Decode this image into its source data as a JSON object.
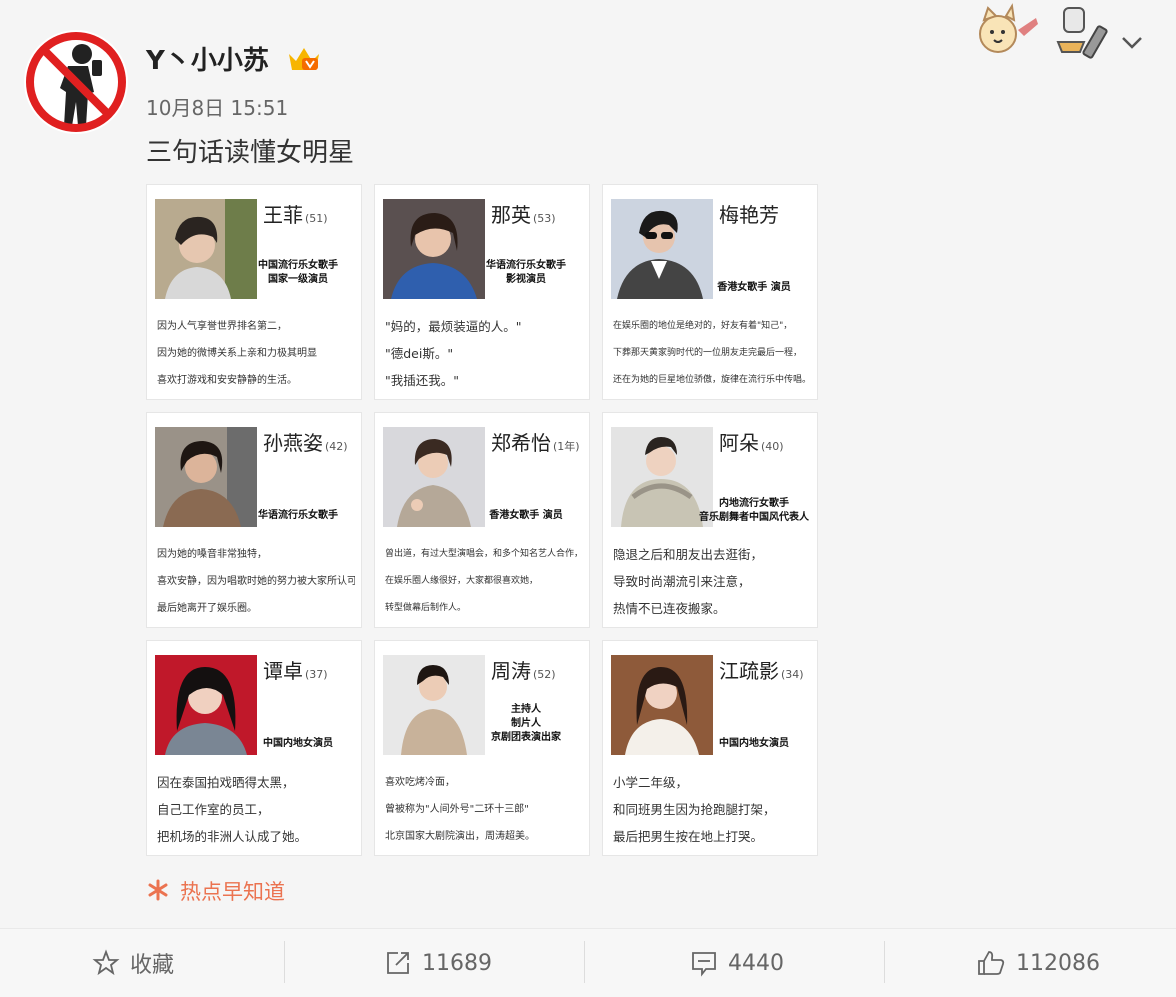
{
  "post": {
    "username": "Y丶小小苏",
    "time": "10月8日 15:51",
    "text": "三句话读懂女明星"
  },
  "cards": [
    {
      "name": "王菲",
      "age": "(51)",
      "role": [
        "中国流行乐女歌手",
        "国家一级演员"
      ],
      "lines": [
        "因为人气享誉世界排名第二，",
        "因为她的微博关系上亲和力极其明显",
        "喜欢打游戏和安安静静的生活。"
      ]
    },
    {
      "name": "那英",
      "age": "(53)",
      "role": [
        "华语流行乐女歌手",
        "影视演员"
      ],
      "lines": [
        "\"妈的，最烦装逼的人。\"",
        "\"德dei斯。\"",
        "\"我插还我。\""
      ]
    },
    {
      "name": "梅艳芳",
      "age": "",
      "role": [
        "香港女歌手 演员"
      ],
      "lines": [
        "在娱乐圈的地位是绝对的，好友有着\"知己\"，",
        "下葬那天黄家驹时代的一位朋友走完最后一程，",
        "还在为她的巨星地位骄傲，旋律在流行乐中传唱。"
      ]
    },
    {
      "name": "孙燕姿",
      "age": "(42)",
      "role": [
        "华语流行乐女歌手"
      ],
      "lines": [
        "因为她的嗓音非常独特，",
        "喜欢安静，因为唱歌时她的努力被大家所认可，",
        "最后她离开了娱乐圈。"
      ]
    },
    {
      "name": "郑希怡",
      "age": "(1年)",
      "role": [
        "香港女歌手 演员"
      ],
      "lines": [
        "曾出道，有过大型演唱会，和多个知名艺人合作，",
        "在娱乐圈人缘很好，大家都很喜欢她，",
        "转型做幕后制作人。"
      ]
    },
    {
      "name": "阿朵",
      "age": "(40)",
      "role": [
        "内地流行女歌手",
        "音乐剧舞者中国风代表人"
      ],
      "lines": [
        "隐退之后和朋友出去逛街，",
        "导致时尚潮流引来注意，",
        "热情不已连夜搬家。"
      ]
    },
    {
      "name": "谭卓",
      "age": "(37)",
      "role": [
        "中国内地女演员"
      ],
      "lines": [
        "因在泰国拍戏晒得太黑，",
        "自己工作室的员工，",
        "把机场的非洲人认成了她。"
      ]
    },
    {
      "name": "周涛",
      "age": "(52)",
      "role": [
        "主持人",
        "制片人",
        "京剧团表演出家"
      ],
      "lines": [
        "喜欢吃烤冷面，",
        "曾被称为\"人间外号\"二环十三郎\"",
        "北京国家大剧院演出，周涛超美。"
      ]
    },
    {
      "name": "江疏影",
      "age": "(34)",
      "role": [
        "中国内地女演员"
      ],
      "lines": [
        "小学二年级，",
        "和同班男生因为抢跑腿打架，",
        "最后把男生按在地上打哭。"
      ]
    }
  ],
  "hot_topic": "热点早知道",
  "actions": {
    "favorite": "收藏",
    "repost": "11689",
    "comment": "4440",
    "like": "112086"
  }
}
